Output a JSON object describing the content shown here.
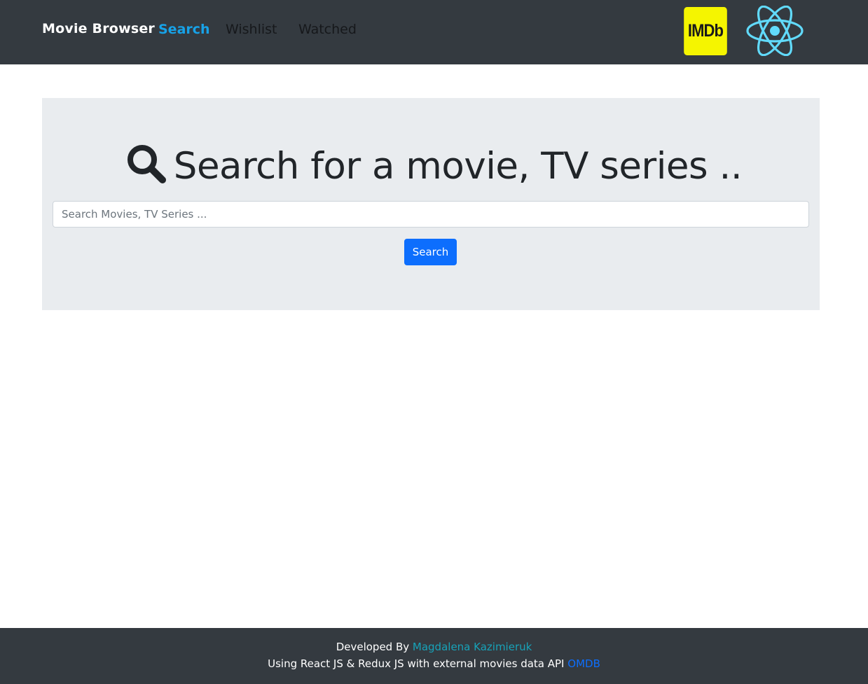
{
  "navbar": {
    "brand": "Movie Browser",
    "links": [
      {
        "label": "Search",
        "active": true
      },
      {
        "label": "Wishlist",
        "active": false
      },
      {
        "label": "Watched",
        "active": false
      }
    ],
    "imdb_logo_text": "IMDb",
    "imdb_color": "#f5f500",
    "react_logo_icon": "react-atom-icon",
    "react_color": "#61dafb"
  },
  "hero": {
    "icon": "search-icon",
    "title": "Search for a movie, TV series .."
  },
  "search": {
    "placeholder": "Search Movies, TV Series ...",
    "value": "",
    "button_label": "Search",
    "button_color": "#0d6efd"
  },
  "footer": {
    "developed_by": "Developed By",
    "author": "Magdalena Kazimieruk",
    "using_text": "Using React JS & Redux JS with external movies data API",
    "api_name": "OMDB"
  },
  "colors": {
    "navbar_bg": "#343a40",
    "jumbotron_bg": "#e9ecef",
    "active_link": "#17a2e8",
    "author_link": "#17a2b8"
  }
}
